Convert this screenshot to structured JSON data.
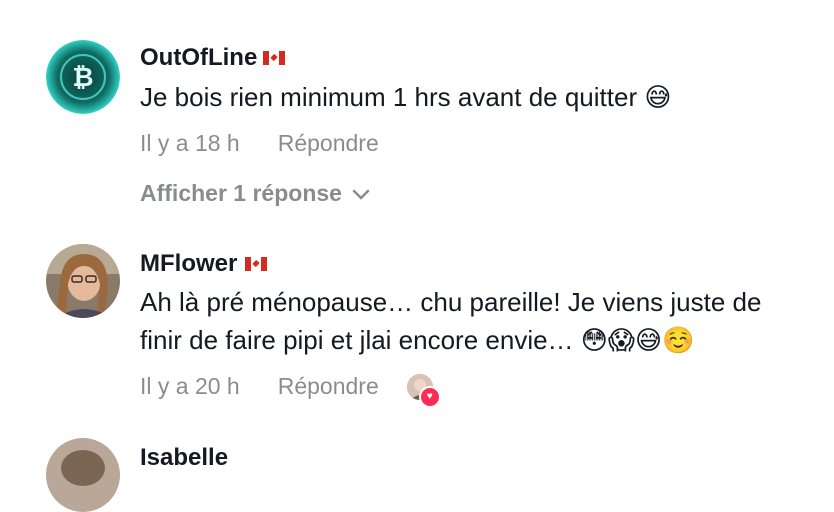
{
  "comments": [
    {
      "username": "OutOfLine",
      "flag": "canada-flag-icon",
      "text": "Je bois rien minimum 1 hrs avant de quitter 😅",
      "time": "Il y a 18 h",
      "reply_label": "Répondre",
      "view_replies_label": "Afficher 1 réponse"
    },
    {
      "username": "MFlower",
      "flag": "canada-flag-icon",
      "text": "Ah là pré ménopause… chu pareille! Je viens juste de finir de faire pipi et jlai encore envie… 😳😱😅☺️",
      "time": "Il y a 20 h",
      "reply_label": "Répondre",
      "creator_liked": true
    },
    {
      "username": "Isabelle"
    }
  ],
  "colors": {
    "text_primary": "#161823",
    "text_secondary": "rgba(22,24,35,0.5)",
    "like_accent": "#fe2c55"
  }
}
